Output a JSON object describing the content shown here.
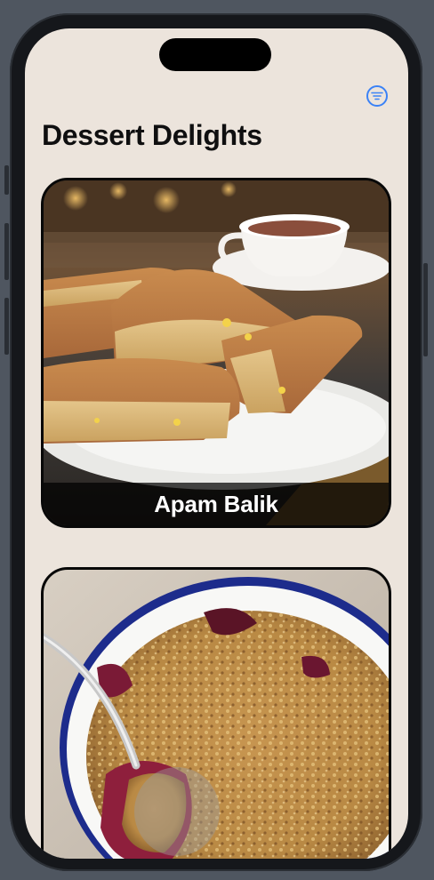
{
  "app": {
    "title": "Dessert Delights",
    "filter_icon": "filter-lines-icon",
    "accent_color": "#3b82f6"
  },
  "desserts": [
    {
      "name": "Apam Balik",
      "image": "apam-balik-photo"
    },
    {
      "name": "",
      "image": "berry-crumble-photo"
    }
  ]
}
